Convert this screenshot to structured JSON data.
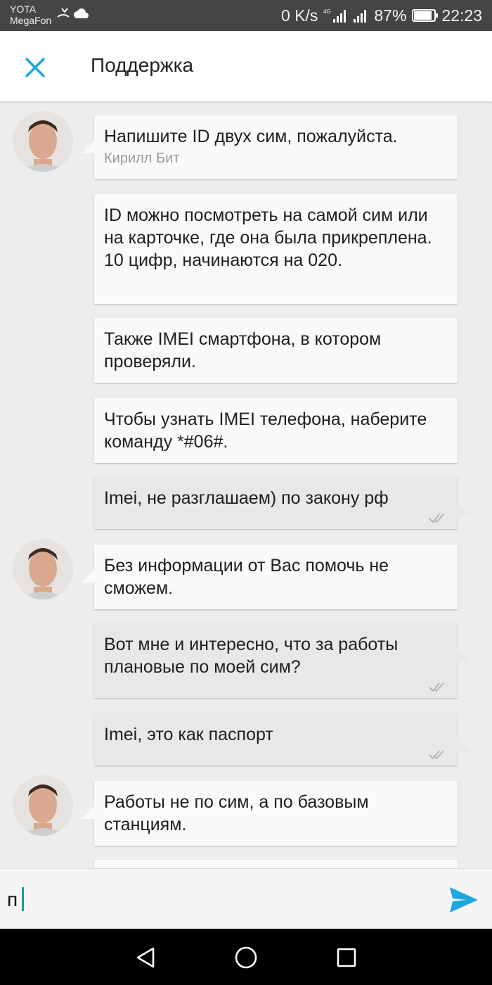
{
  "status_bar": {
    "carrier_1": "YOTA",
    "carrier_2": "MegaFon",
    "speed": "0 K/s",
    "net_type": "4G",
    "battery": "87%",
    "battery_level": 0.87,
    "time": "22:23"
  },
  "header": {
    "title": "Поддержка"
  },
  "messages": [
    {
      "text": "Напишите ID двух сим, пожалуйста.",
      "author": "Кирилл Бит"
    },
    {
      "text": "ID можно посмотреть на самой сим или на карточке, где она была прикреплена. 10 цифр, начинаются на 020."
    },
    {
      "text": "Также IMEI смартфона, в котором проверяли."
    },
    {
      "text": "Чтобы узнать IMEI телефона, наберите команду *#06#."
    },
    {
      "text": "Imei, не разглашаем) по закону рф"
    },
    {
      "text": "Без информации от Вас помочь не сможем."
    },
    {
      "text": "Вот мне и интересно, что за работы плановые по моей сим?"
    },
    {
      "text": "Imei, это как паспорт"
    },
    {
      "text": "Работы не по сим, а по базовым станциям."
    }
  ],
  "input": {
    "value": "п"
  },
  "colors": {
    "accent": "#1ea7e1",
    "status_bar": "#454545",
    "outgoing_bubble": "#e8e8e8",
    "incoming_bubble": "#fafafa"
  }
}
